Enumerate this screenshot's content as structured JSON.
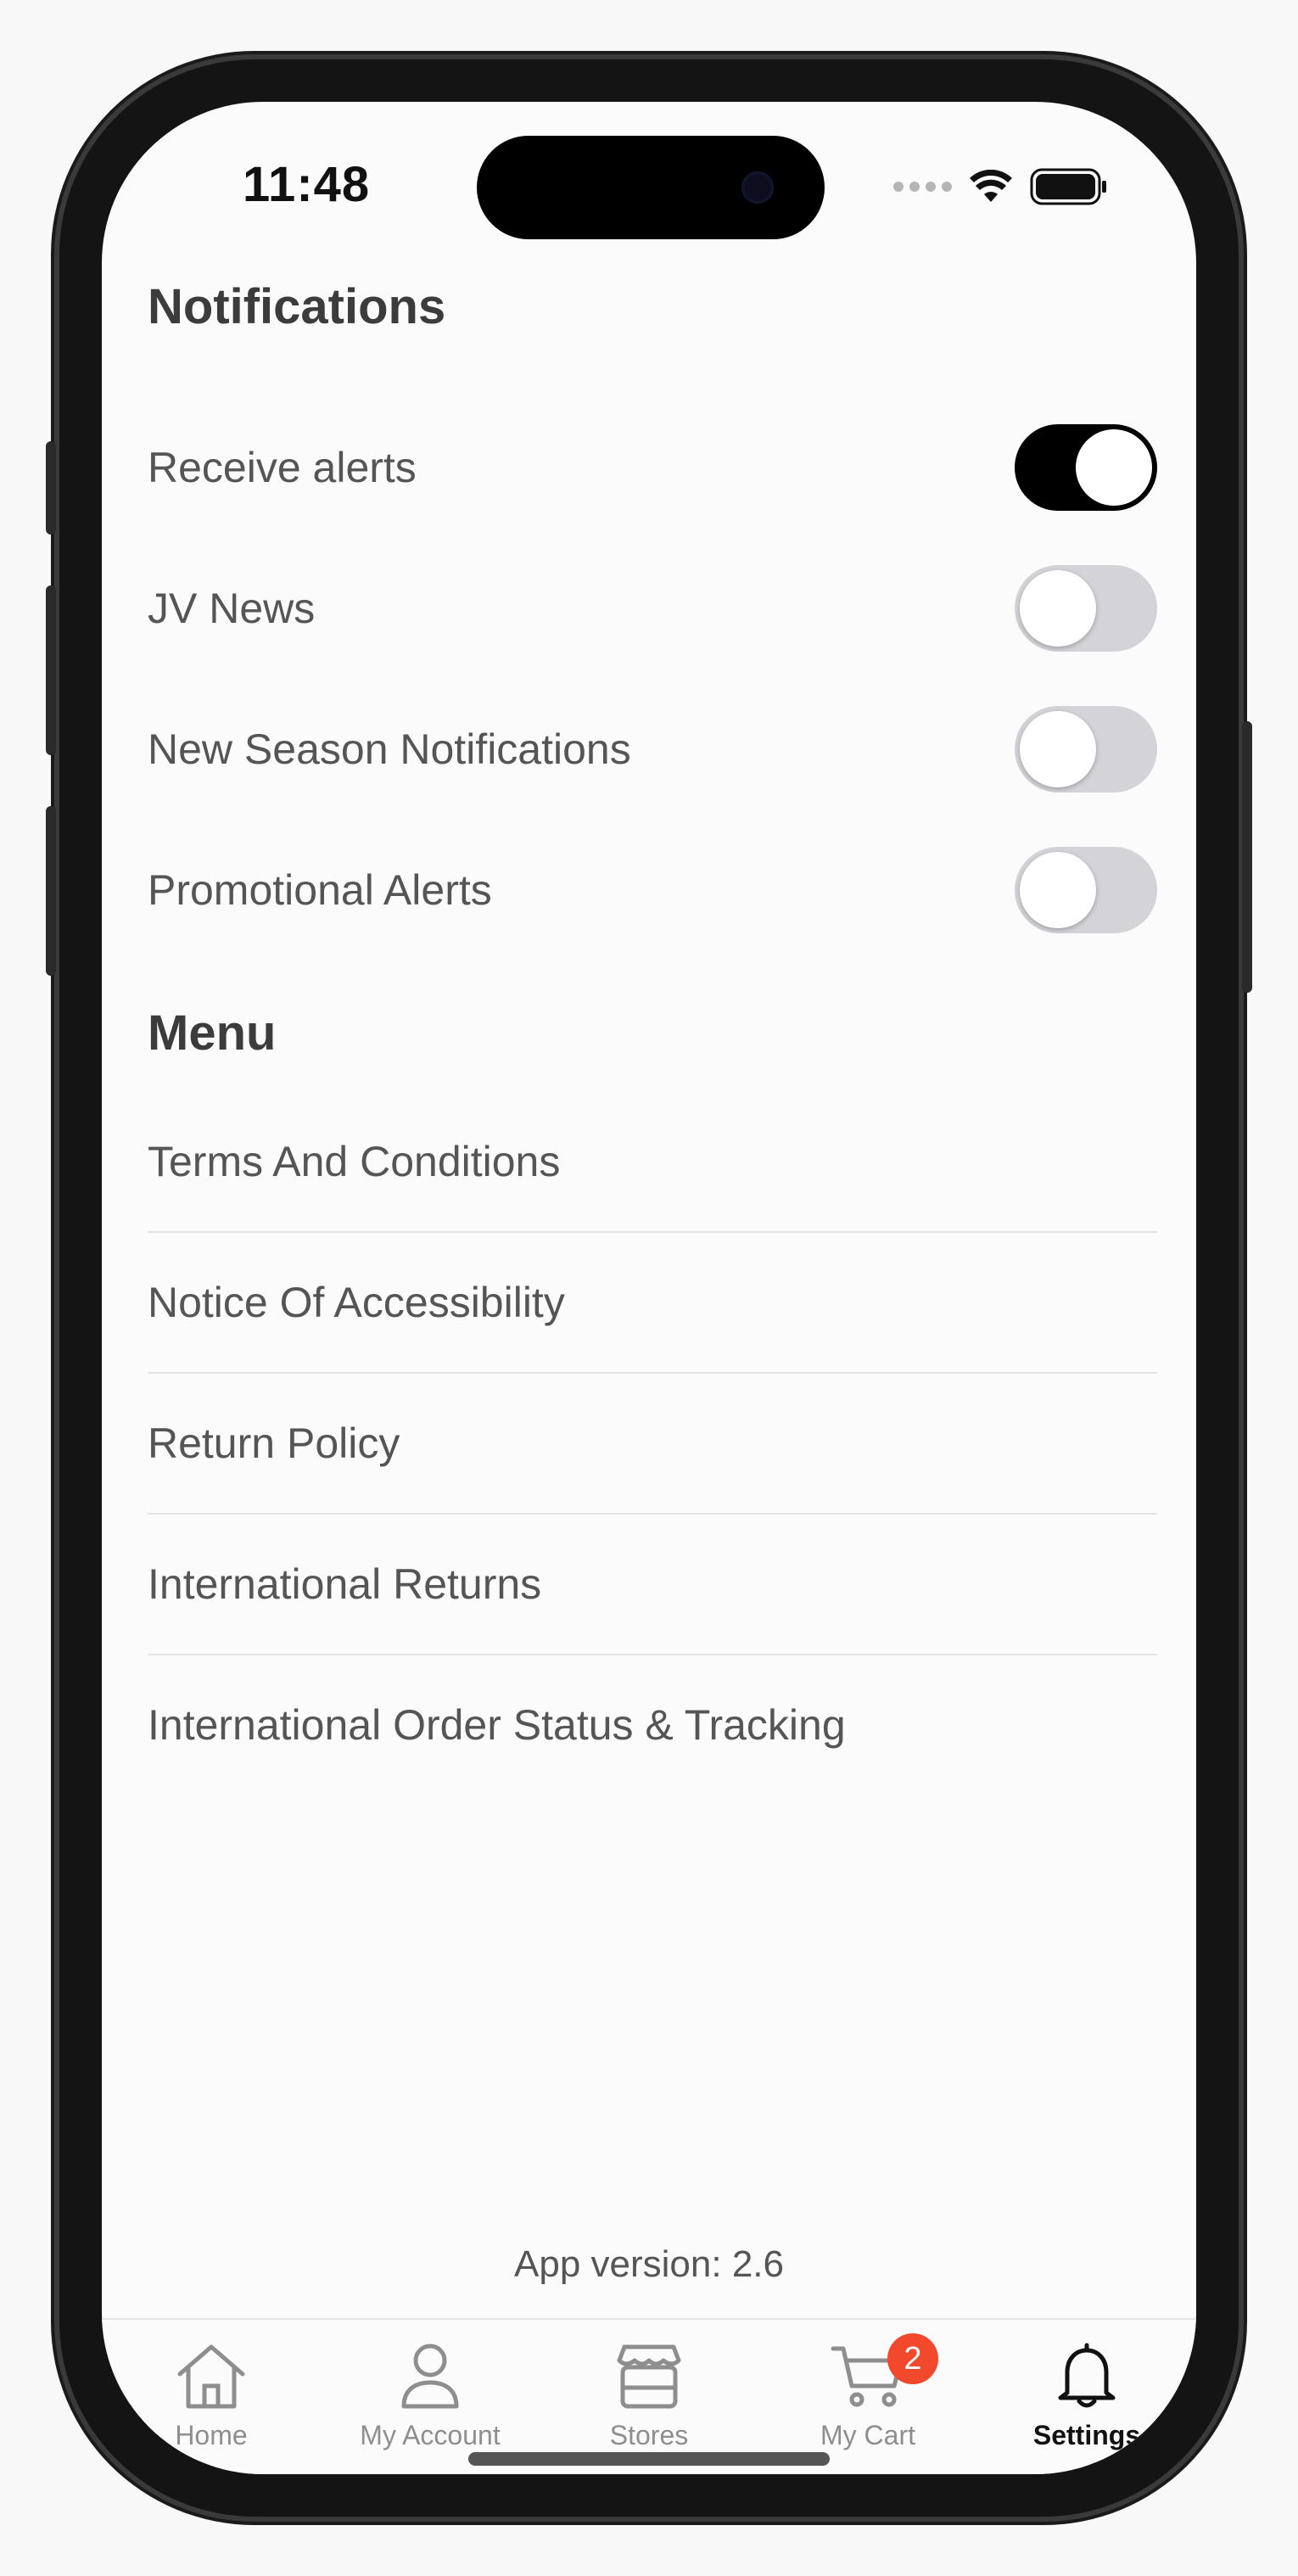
{
  "status_bar": {
    "time": "11:48"
  },
  "notifications": {
    "title": "Notifications",
    "toggles": [
      {
        "label": "Receive alerts",
        "on": true
      },
      {
        "label": "JV News",
        "on": false
      },
      {
        "label": "New Season Notifications",
        "on": false
      },
      {
        "label": "Promotional Alerts",
        "on": false
      }
    ]
  },
  "menu": {
    "title": "Menu",
    "items": [
      {
        "label": "Terms And Conditions"
      },
      {
        "label": "Notice Of Accessibility"
      },
      {
        "label": "Return Policy"
      },
      {
        "label": "International Returns"
      },
      {
        "label": "International Order Status & Tracking"
      }
    ]
  },
  "footer": {
    "app_version": "App version: 2.6"
  },
  "tabbar": {
    "tabs": [
      {
        "label": "Home",
        "icon": "home-icon",
        "active": false
      },
      {
        "label": "My Account",
        "icon": "person-icon",
        "active": false
      },
      {
        "label": "Stores",
        "icon": "store-icon",
        "active": false
      },
      {
        "label": "My Cart",
        "icon": "cart-icon",
        "active": false,
        "badge": "2"
      },
      {
        "label": "Settings",
        "icon": "bell-icon",
        "active": true
      }
    ]
  },
  "colors": {
    "toggle_on": "#000000",
    "toggle_off": "#d4d3d8",
    "badge": "#f2492c",
    "text": "#555555"
  }
}
